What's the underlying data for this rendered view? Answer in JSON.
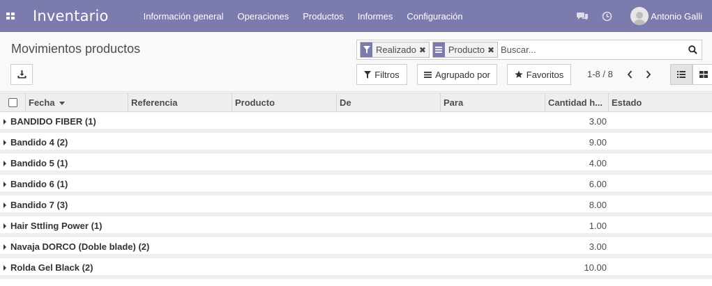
{
  "navbar": {
    "brand": "Inventario",
    "menu": [
      "Información general",
      "Operaciones",
      "Productos",
      "Informes",
      "Configuración"
    ],
    "user": "Antonio Galli",
    "color": "#7c7bad"
  },
  "control": {
    "title": "Movimientos productos",
    "search": {
      "facets": [
        {
          "icon": "filter-icon",
          "label": "Realizado"
        },
        {
          "icon": "group-list-icon",
          "label": "Producto"
        }
      ],
      "placeholder": "Buscar..."
    },
    "buttons": {
      "filters": "Filtros",
      "groupby": "Agrupado por",
      "favorites": "Favoritos"
    },
    "pager": "1-8 / 8"
  },
  "table": {
    "headers": [
      "Fecha",
      "Referencia",
      "Producto",
      "De",
      "Para",
      "Cantidad h...",
      "Estado"
    ],
    "groups": [
      {
        "label": "BANDIDO FIBER (1)",
        "qty": "3.00"
      },
      {
        "label": "Bandido 4 (2)",
        "qty": "9.00"
      },
      {
        "label": "Bandido 5 (1)",
        "qty": "4.00"
      },
      {
        "label": "Bandido 6 (1)",
        "qty": "6.00"
      },
      {
        "label": "Bandido 7 (3)",
        "qty": "8.00"
      },
      {
        "label": "Hair Sttling Power (1)",
        "qty": "1.00"
      },
      {
        "label": "Navaja DORCO (Doble blade) (2)",
        "qty": "3.00"
      },
      {
        "label": "Rolda Gel Black (2)",
        "qty": "10.00"
      }
    ]
  }
}
